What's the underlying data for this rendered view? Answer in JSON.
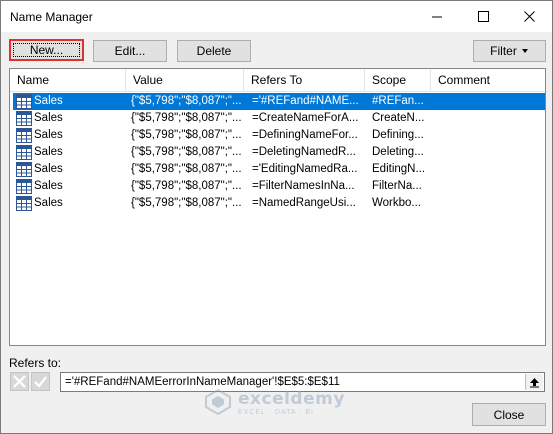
{
  "window": {
    "title": "Name Manager"
  },
  "toolbar": {
    "new_label": "New...",
    "edit_label": "Edit...",
    "delete_label": "Delete",
    "filter_label": "Filter"
  },
  "columns": [
    "Name",
    "Value",
    "Refers To",
    "Scope",
    "Comment"
  ],
  "rows": [
    {
      "name": "Sales",
      "value": "{\"$5,798\";\"$8,087\";\"...",
      "refers": "='#REFand#NAME...",
      "scope": "#REFan...",
      "comment": "",
      "selected": true
    },
    {
      "name": "Sales",
      "value": "{\"$5,798\";\"$8,087\";\"...",
      "refers": "=CreateNameForA...",
      "scope": "CreateN...",
      "comment": "",
      "selected": false
    },
    {
      "name": "Sales",
      "value": "{\"$5,798\";\"$8,087\";\"...",
      "refers": "=DefiningNameFor...",
      "scope": "Defining...",
      "comment": "",
      "selected": false
    },
    {
      "name": "Sales",
      "value": "{\"$5,798\";\"$8,087\";\"...",
      "refers": "=DeletingNamedR...",
      "scope": "Deleting...",
      "comment": "",
      "selected": false
    },
    {
      "name": "Sales",
      "value": "{\"$5,798\";\"$8,087\";\"...",
      "refers": "='EditingNamedRa...",
      "scope": "EditingN...",
      "comment": "",
      "selected": false
    },
    {
      "name": "Sales",
      "value": "{\"$5,798\";\"$8,087\";\"...",
      "refers": "=FilterNamesInNa...",
      "scope": "FilterNa...",
      "comment": "",
      "selected": false
    },
    {
      "name": "Sales",
      "value": "{\"$5,798\";\"$8,087\";\"...",
      "refers": "=NamedRangeUsi...",
      "scope": "Workbo...",
      "comment": "",
      "selected": false
    }
  ],
  "refers_to": {
    "label": "Refers to:",
    "value": "='#REFand#NAMEerrorInNameManager'!$E$5:$E$11"
  },
  "footer": {
    "close_label": "Close"
  },
  "watermark": {
    "name": "exceldemy",
    "tagline": "EXCEL · DATA · BI"
  },
  "colors": {
    "selection": "#0078d7",
    "highlight_border": "#e03030"
  }
}
